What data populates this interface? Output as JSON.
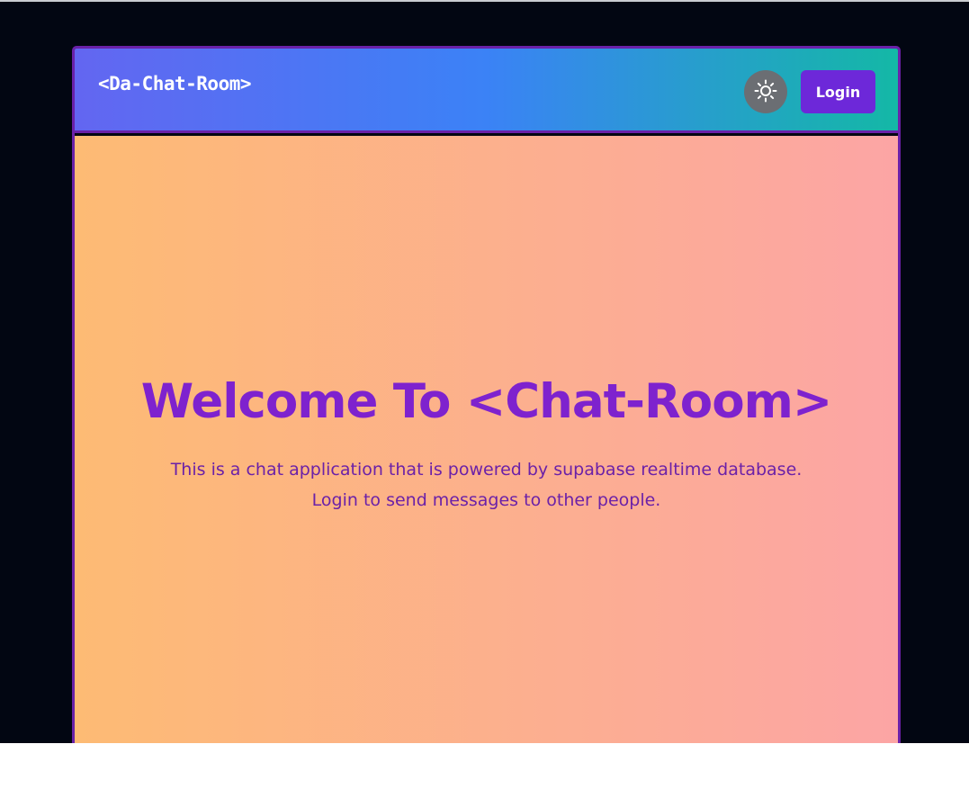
{
  "header": {
    "brand": "<Da-Chat-Room>",
    "theme_toggle_icon": "sun-icon",
    "login_label": "Login"
  },
  "hero": {
    "title": "Welcome To <Chat-Room>",
    "line1": "This is a chat application that is powered by supabase realtime database.",
    "line2": "Login to send messages to other people."
  },
  "colors": {
    "page_background": "#020612",
    "frame_border": "#6a21a8",
    "header_gradient": [
      "#6366f1",
      "#3b82f6",
      "#14b8a6"
    ],
    "login_button": "#6d28d9",
    "theme_toggle": "#6b6e73",
    "main_gradient": [
      "#fdbb74",
      "#fca5a5"
    ],
    "hero_title": "#7e22ce",
    "hero_text": "#6b21a8"
  }
}
